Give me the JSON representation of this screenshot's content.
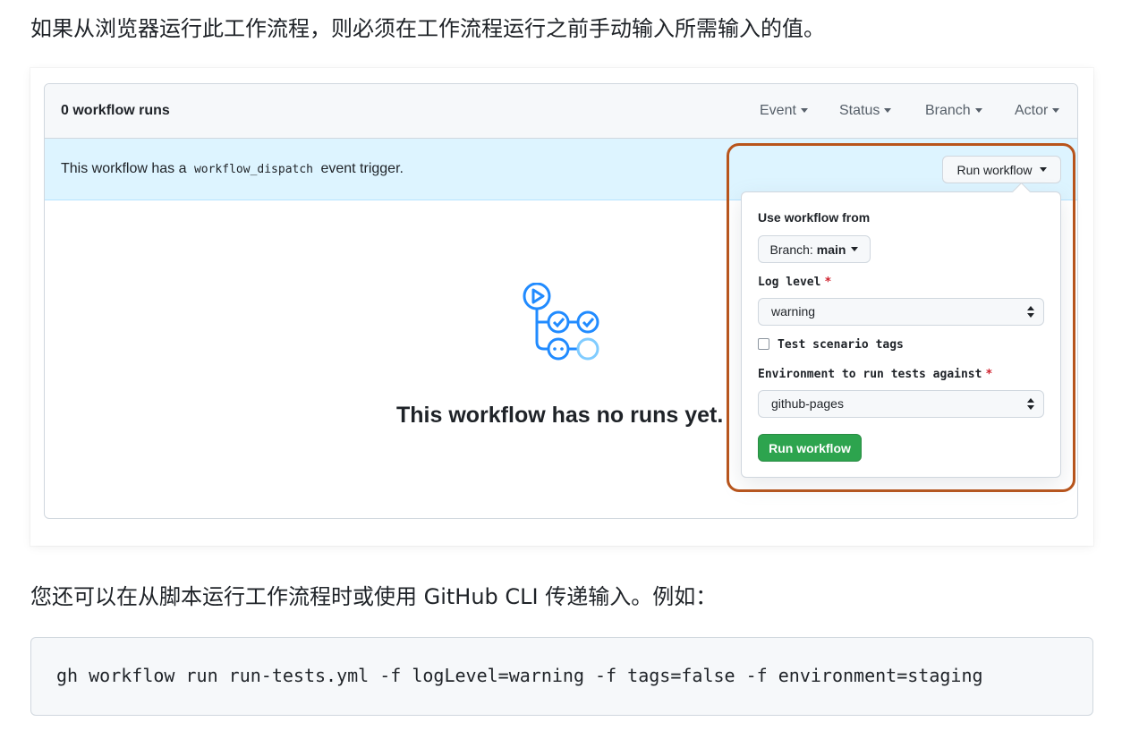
{
  "intro_text": "如果从浏览器运行此工作流程，则必须在工作流程运行之前手动输入所需输入的值。",
  "header": {
    "runs_count": "0 workflow runs",
    "filters": [
      "Event",
      "Status",
      "Branch",
      "Actor"
    ]
  },
  "trigger_bar": {
    "prefix": "This workflow has a",
    "code": "workflow_dispatch",
    "suffix": "event trigger."
  },
  "empty_state": {
    "title": "This workflow has no runs yet.",
    "icon": "workflow-graph-icon"
  },
  "run_button": {
    "label": "Run workflow"
  },
  "dropdown": {
    "use_from_label": "Use workflow from",
    "branch_prefix": "Branch:",
    "branch_value": "main",
    "log_level_label": "Log level",
    "required_mark": "*",
    "log_level_value": "warning",
    "tags_label": "Test scenario tags",
    "tags_checked": false,
    "environment_label": "Environment to run tests against",
    "environment_value": "github-pages",
    "submit_label": "Run workflow"
  },
  "para2_text": "您还可以在从脚本运行工作流程时或使用 GitHub CLI 传递输入。例如：",
  "code_example": "gh workflow run run-tests.yml -f logLevel=warning -f tags=false -f environment=staging",
  "colors": {
    "accent_green": "#2da44e",
    "highlight_border": "#b8541b",
    "info_bg": "#ddf4ff",
    "icon_blue": "#218bff"
  }
}
